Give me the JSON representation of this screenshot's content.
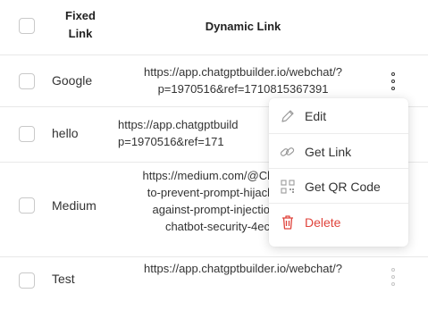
{
  "header": {
    "fixed_link": "Fixed\nLink",
    "dynamic_link": "Dynamic Link"
  },
  "rows": [
    {
      "fixed": "Google",
      "dynamic": "https://app.chatgptbuilder.io/webchat/?\np=1970516&ref=1710815367391"
    },
    {
      "fixed": "hello",
      "dynamic": "https://app.chatgptbuild\np=1970516&ref=171"
    },
    {
      "fixed": "Medium",
      "dynamic": "https://medium.com/@Cl\nto-prevent-prompt-hijacl\nagainst-prompt-injectio\nchatbot-security-4ec"
    },
    {
      "fixed": "Test",
      "dynamic": "https://app.chatgptbuilder.io/webchat/?"
    }
  ],
  "menu": {
    "edit": "Edit",
    "get_link": "Get Link",
    "get_qr": "Get QR Code",
    "delete": "Delete"
  },
  "colors": {
    "danger": "#e0443c",
    "border": "#e8e8e8",
    "icon_gray": "#9a9a9a"
  },
  "icons": [
    "pencil-icon",
    "link-icon",
    "qr-code-icon",
    "trash-icon",
    "kebab-menu-icon"
  ]
}
